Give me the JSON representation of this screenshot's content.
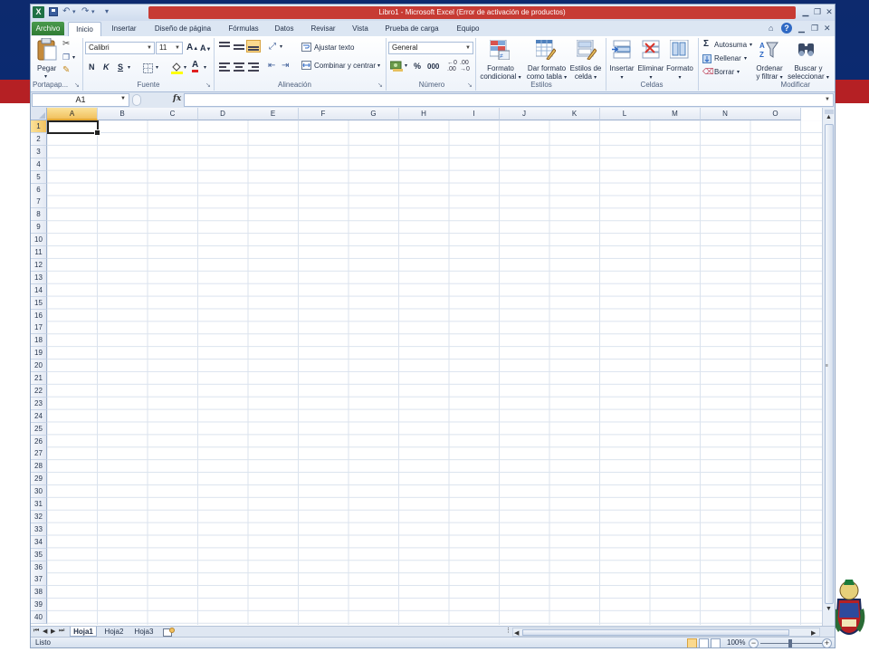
{
  "window": {
    "title": "Libro1  -  Microsoft Excel (Error de activación de productos)",
    "app_icon": "X",
    "title_color": "#c73b34"
  },
  "quick_access": {
    "undo": "↶",
    "redo": "↷",
    "customize": "▾"
  },
  "tabs": {
    "file": "Archivo",
    "items": [
      {
        "label": "Inicio",
        "active": true
      },
      {
        "label": "Insertar"
      },
      {
        "label": "Diseño de página"
      },
      {
        "label": "Fórmulas"
      },
      {
        "label": "Datos"
      },
      {
        "label": "Revisar"
      },
      {
        "label": "Vista"
      },
      {
        "label": "Prueba de carga"
      },
      {
        "label": "Equipo"
      }
    ]
  },
  "ribbon": {
    "clipboard": {
      "paste": "Pegar",
      "group": "Portapap..."
    },
    "font": {
      "name": "Calibri",
      "size": "11",
      "bold": "N",
      "italic": "K",
      "underline": "S",
      "group": "Fuente"
    },
    "alignment": {
      "wrap": "Ajustar texto",
      "merge": "Combinar y centrar",
      "group": "Alineación"
    },
    "number": {
      "format": "General",
      "percent": "%",
      "thousands": "000",
      "group": "Número"
    },
    "styles": {
      "conditional": [
        "Formato",
        "condicional"
      ],
      "as_table": [
        "Dar formato",
        "como tabla"
      ],
      "cell_styles": [
        "Estilos de",
        "celda"
      ],
      "group": "Estilos"
    },
    "cells": {
      "insert": "Insertar",
      "delete": "Eliminar",
      "format": "Formato",
      "group": "Celdas"
    },
    "editing": {
      "autosum": "Autosuma",
      "fill": "Rellenar",
      "clear": "Borrar",
      "sort": [
        "Ordenar",
        "y filtrar"
      ],
      "find": [
        "Buscar y",
        "seleccionar"
      ],
      "group": "Modificar"
    }
  },
  "formula_bar": {
    "name_box": "A1",
    "fx": "fx",
    "value": ""
  },
  "grid": {
    "columns": [
      "A",
      "B",
      "C",
      "D",
      "E",
      "F",
      "G",
      "H",
      "I",
      "J",
      "K",
      "L",
      "M",
      "N",
      "O"
    ],
    "rows": [
      "1",
      "2",
      "3",
      "4",
      "5",
      "6",
      "7",
      "8",
      "9",
      "10",
      "11",
      "12",
      "13",
      "14",
      "15",
      "16",
      "17",
      "18",
      "19",
      "20",
      "21",
      "22",
      "23",
      "24",
      "25",
      "26",
      "27",
      "28",
      "29",
      "30",
      "31",
      "32",
      "33",
      "34",
      "35",
      "36",
      "37",
      "38",
      "39",
      "40"
    ],
    "selected_cell": "A1"
  },
  "sheets": [
    {
      "label": "Hoja1",
      "active": true
    },
    {
      "label": "Hoja2"
    },
    {
      "label": "Hoja3"
    }
  ],
  "status": {
    "text": "Listo",
    "zoom": "100%"
  }
}
